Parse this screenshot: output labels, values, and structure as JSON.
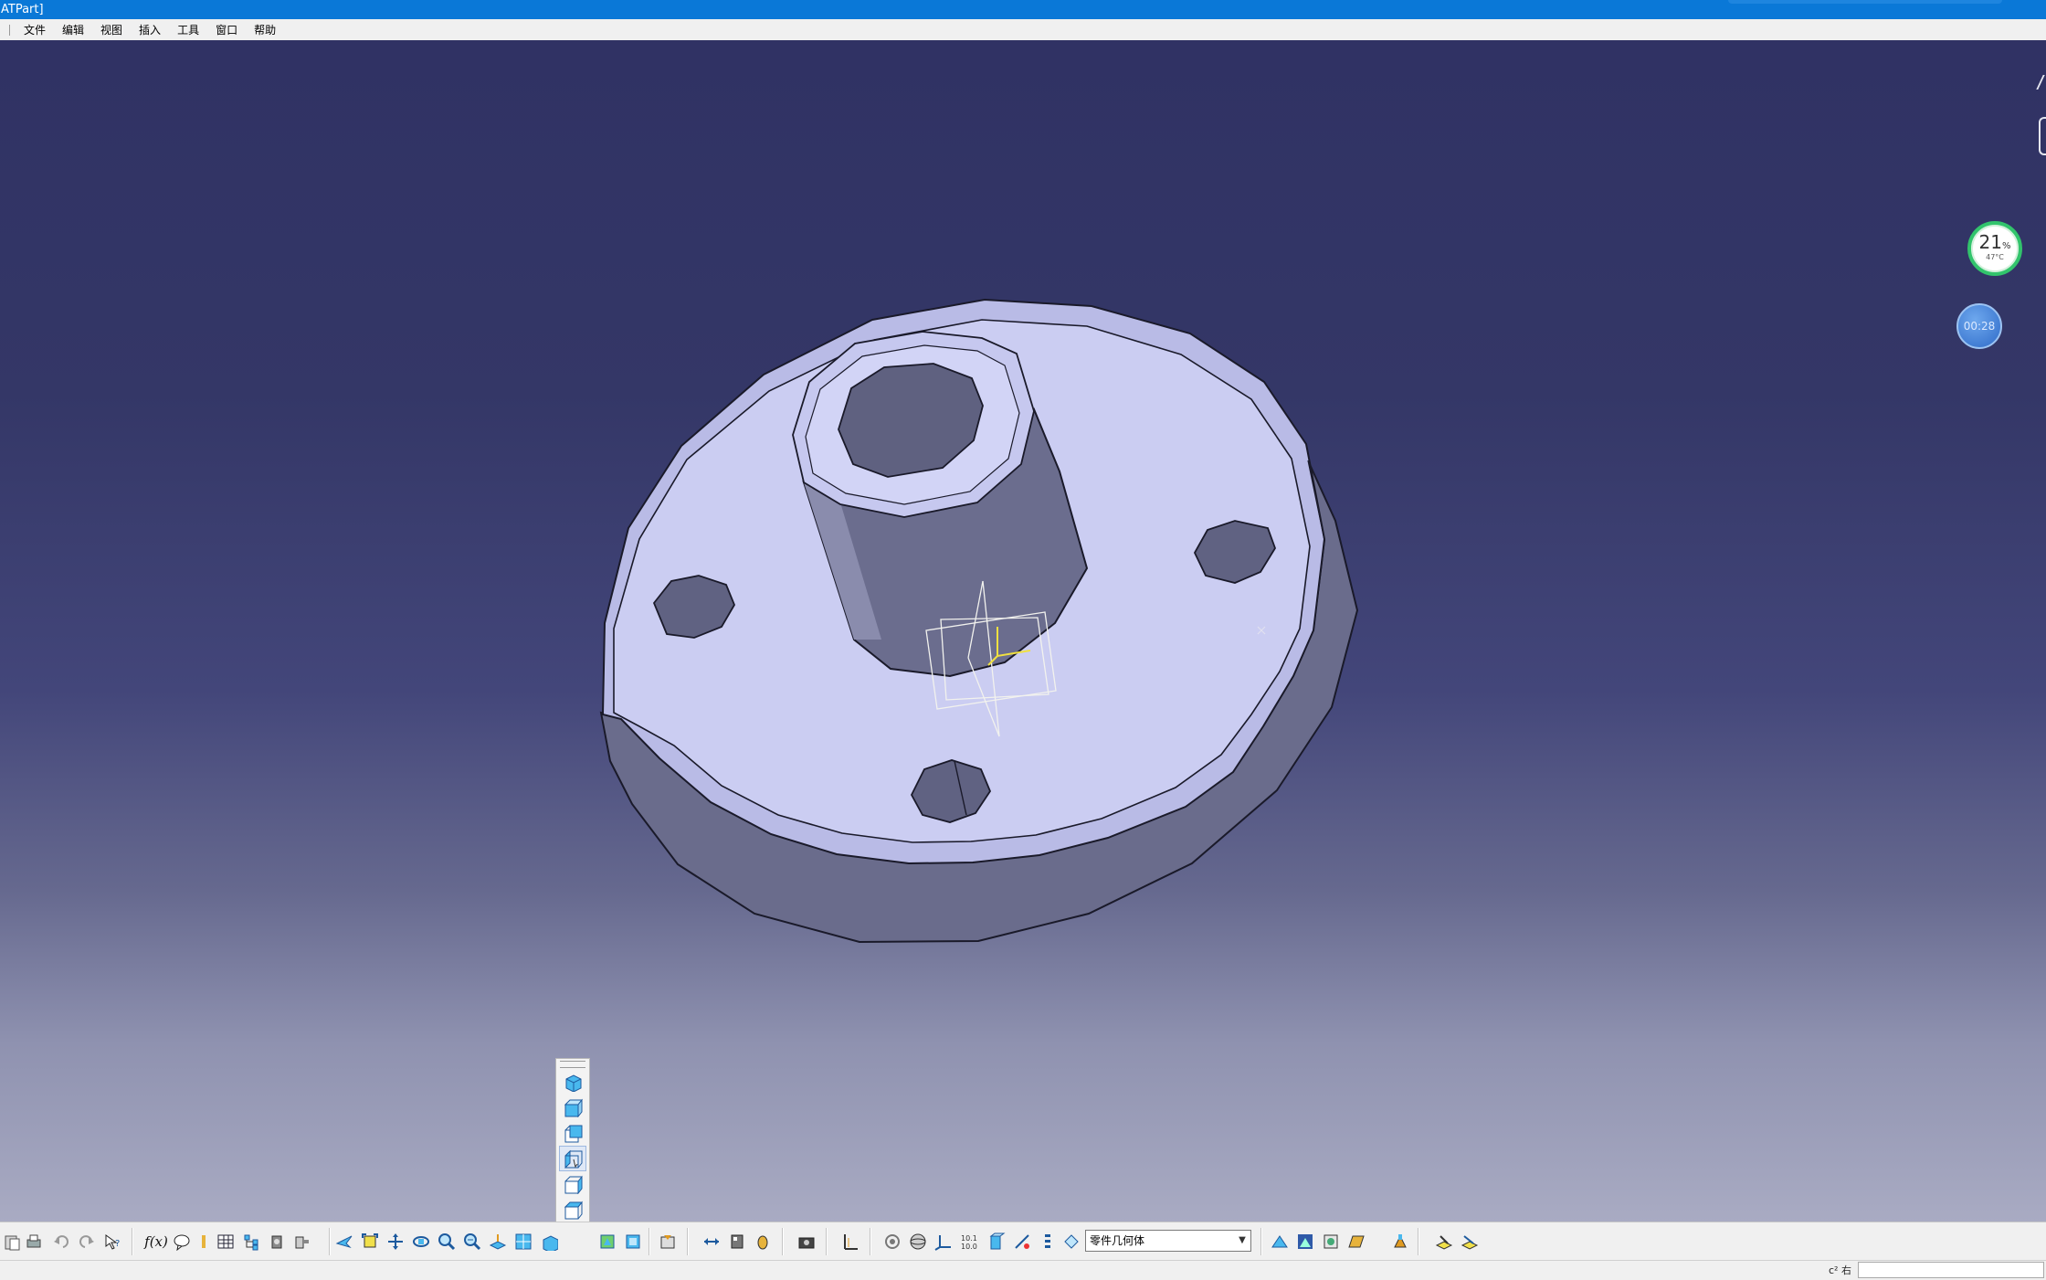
{
  "window": {
    "title": "ATPart]"
  },
  "menu": {
    "items": [
      {
        "label": "",
        "name": "menu-start-fragment"
      },
      {
        "label": "文件"
      },
      {
        "label": "编辑"
      },
      {
        "label": "视图"
      },
      {
        "label": "插入"
      },
      {
        "label": "工具"
      },
      {
        "label": "窗口"
      },
      {
        "label": "帮助"
      }
    ]
  },
  "overlay": {
    "gauge": {
      "percent": "21",
      "percent_sign": "%",
      "temp": "47°C"
    },
    "timer": "00:28"
  },
  "toolbar": {
    "body_select": {
      "value": "零件几何体"
    },
    "fx_label": "f(x)"
  },
  "view_toolbar": {
    "items": [
      "isometric-view-icon",
      "front-view-icon",
      "back-view-icon",
      "left-view-icon",
      "right-view-icon",
      "top-view-icon",
      "bottom-view-icon",
      "named-views-icon"
    ],
    "active_index": 3
  },
  "statusbar": {
    "cmd_label": "c² 右",
    "cmd_value": ""
  },
  "colors": {
    "title_bar": "#0a78d7",
    "viewport_top": "#303264",
    "viewport_bottom": "#a9abc3",
    "part_face": "#cacbf0",
    "part_side": "#6d6f90",
    "hole": "#616382",
    "axis_system": "#f0e040",
    "gauge_ring": "#32c46c",
    "timer_bubble": "#2f6bc8"
  }
}
